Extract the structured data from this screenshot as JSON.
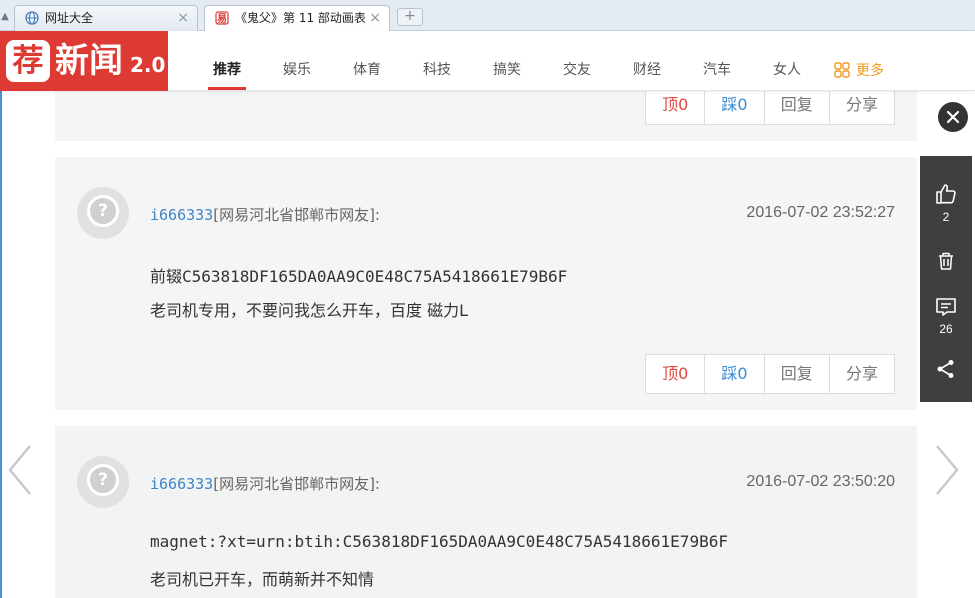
{
  "browser": {
    "tabs": [
      {
        "title": "网址大全",
        "icon": "globe-icon",
        "active": false
      },
      {
        "title": "《鬼父》第 11 部动画表",
        "icon": "netease-icon",
        "active": true
      }
    ],
    "new_tab_label": "+",
    "close_glyph": "×",
    "scroll_glyph": "▲"
  },
  "site": {
    "logo_badge": "荐",
    "logo_text": "新闻",
    "logo_version": "2.0",
    "brand_color": "#dd3a33",
    "nav": [
      "推荐",
      "娱乐",
      "体育",
      "科技",
      "搞笑",
      "交友",
      "财经",
      "汽车",
      "女人"
    ],
    "nav_active_index": 0,
    "nav_more": "更多"
  },
  "comments": [
    {
      "user": "i666333",
      "location": "[网易河北省邯郸市网友]:",
      "time": "2016-07-02 23:52:27",
      "lines": [
        "前辍C563818DF165DA0AA9C0E48C75A5418661E79B6F",
        "老司机专用，不要问我怎么开车，百度 磁力L"
      ]
    },
    {
      "user": "i666333",
      "location": "[网易河北省邯郸市网友]:",
      "time": "2016-07-02 23:50:20",
      "lines": [
        "magnet:?xt=urn:btih:C563818DF165DA0AA9C0E48C75A5418661E79B6F",
        "老司机已开车，而萌新并不知情"
      ]
    }
  ],
  "actions": {
    "up": "顶0",
    "down": "踩0",
    "reply": "回复",
    "share": "分享"
  },
  "tools": {
    "like_count": "2",
    "comment_count": "26"
  }
}
